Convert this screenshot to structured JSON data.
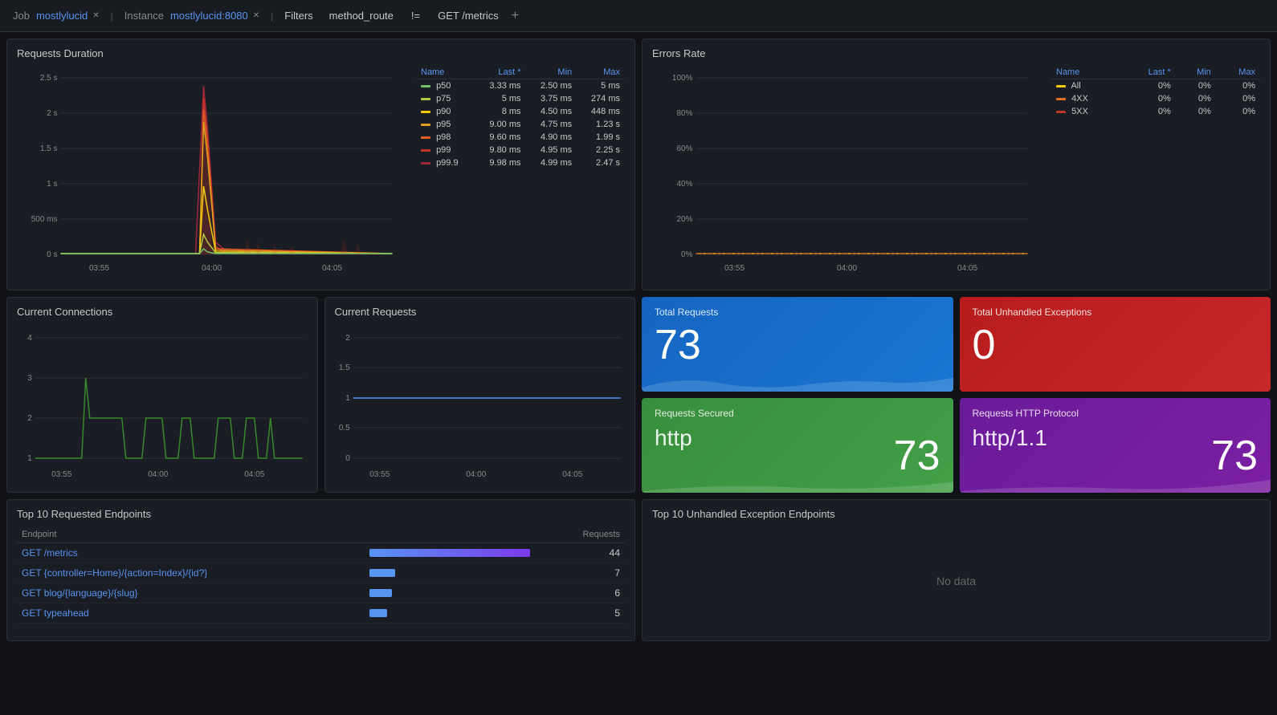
{
  "nav": {
    "job_label": "Job",
    "job_name": "mostlylucid",
    "instance_label": "Instance",
    "instance_name": "mostlylucid:8080",
    "filters_label": "Filters",
    "filter_key": "method_route",
    "filter_op": "!=",
    "filter_val": "GET /metrics",
    "plus_icon": "+"
  },
  "requests_duration": {
    "title": "Requests Duration",
    "legend": [
      {
        "name": "p50",
        "color": "#73bf69",
        "last": "3.33 ms",
        "min": "2.50 ms",
        "max": "5 ms"
      },
      {
        "name": "p75",
        "color": "#b0c945",
        "last": "5 ms",
        "min": "3.75 ms",
        "max": "274 ms"
      },
      {
        "name": "p90",
        "color": "#f2cc0c",
        "last": "8 ms",
        "min": "4.50 ms",
        "max": "448 ms"
      },
      {
        "name": "p95",
        "color": "#e0a020",
        "last": "9.00 ms",
        "min": "4.75 ms",
        "max": "1.23 s"
      },
      {
        "name": "p98",
        "color": "#e05c20",
        "last": "9.60 ms",
        "min": "4.90 ms",
        "max": "1.99 s"
      },
      {
        "name": "p99",
        "color": "#c0362b",
        "last": "9.80 ms",
        "min": "4.95 ms",
        "max": "2.25 s"
      },
      {
        "name": "p99.9",
        "color": "#a0263b",
        "last": "9.98 ms",
        "min": "4.99 ms",
        "max": "2.47 s"
      }
    ],
    "col_name": "Name",
    "col_last": "Last *",
    "col_min": "Min",
    "col_max": "Max",
    "y_labels": [
      "2.5 s",
      "2 s",
      "1.5 s",
      "1 s",
      "500 ms",
      "0 s"
    ],
    "x_labels": [
      "03:55",
      "04:00",
      "04:05"
    ]
  },
  "errors_rate": {
    "title": "Errors Rate",
    "legend": [
      {
        "name": "All",
        "color": "#f2cc0c",
        "last": "0%",
        "min": "0%",
        "max": "0%"
      },
      {
        "name": "4XX",
        "color": "#e07020",
        "last": "0%",
        "min": "0%",
        "max": "0%"
      },
      {
        "name": "5XX",
        "color": "#c0362b",
        "last": "0%",
        "min": "0%",
        "max": "0%"
      }
    ],
    "col_name": "Name",
    "col_last": "Last *",
    "col_min": "Min",
    "col_max": "Max",
    "y_labels": [
      "100%",
      "80%",
      "60%",
      "40%",
      "20%",
      "0%"
    ],
    "x_labels": [
      "03:55",
      "04:00",
      "04:05"
    ]
  },
  "current_connections": {
    "title": "Current Connections",
    "y_labels": [
      "4",
      "3",
      "2",
      "1"
    ],
    "x_labels": [
      "03:55",
      "04:00",
      "04:05"
    ]
  },
  "current_requests": {
    "title": "Current Requests",
    "y_labels": [
      "2",
      "1.5",
      "1",
      "0.5",
      "0"
    ],
    "x_labels": [
      "03:55",
      "04:00",
      "04:05"
    ]
  },
  "total_requests": {
    "title": "Total Requests",
    "value": "73"
  },
  "total_unhandled": {
    "title": "Total Unhandled Exceptions",
    "value": "0"
  },
  "requests_secured": {
    "title": "Requests Secured",
    "label": "http",
    "value": "73"
  },
  "requests_http_protocol": {
    "title": "Requests HTTP Protocol",
    "label": "http/1.1",
    "value": "73"
  },
  "top10_endpoints": {
    "title": "Top 10 Requested Endpoints",
    "col_endpoint": "Endpoint",
    "col_requests": "Requests",
    "rows": [
      {
        "endpoint": "GET /metrics",
        "count": "44",
        "bar_pct": 100,
        "bar_class": "bar-blue-purple"
      },
      {
        "endpoint": "GET {controller=Home}/{action=Index}/{id?}",
        "count": "7",
        "bar_pct": 16,
        "bar_class": "bar-blue"
      },
      {
        "endpoint": "GET blog/{language}/{slug}",
        "count": "6",
        "bar_pct": 14,
        "bar_class": "bar-blue"
      },
      {
        "endpoint": "GET typeahead",
        "count": "5",
        "bar_pct": 11,
        "bar_class": "bar-blue"
      }
    ]
  },
  "top10_exceptions": {
    "title": "Top 10 Unhandled Exception Endpoints",
    "no_data": "No data"
  }
}
